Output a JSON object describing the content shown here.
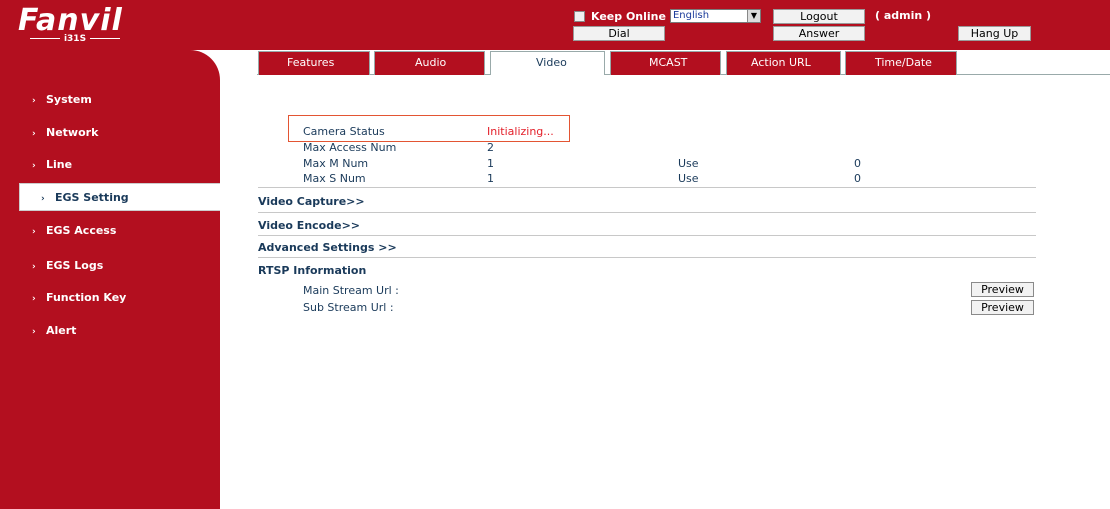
{
  "header": {
    "brand": "Fanvil",
    "model": "i31S",
    "keep_online": "Keep Online",
    "language": "English",
    "logout": "Logout",
    "admin": "( admin )",
    "dial": "Dial",
    "answer": "Answer",
    "hang_up": "Hang Up"
  },
  "sidebar": {
    "items": [
      {
        "label": "System"
      },
      {
        "label": "Network"
      },
      {
        "label": "Line"
      },
      {
        "label": "EGS Setting"
      },
      {
        "label": "EGS Access"
      },
      {
        "label": "EGS Logs"
      },
      {
        "label": "Function Key"
      },
      {
        "label": "Alert"
      }
    ],
    "active_index": 3
  },
  "tabs": [
    {
      "label": "Features"
    },
    {
      "label": "Audio"
    },
    {
      "label": "Video"
    },
    {
      "label": "MCAST"
    },
    {
      "label": "Action URL"
    },
    {
      "label": "Time/Date"
    }
  ],
  "active_tab": 2,
  "status": {
    "camera_status_label": "Camera Status",
    "camera_status_value": "Initializing...",
    "max_access_label": "Max Access Num",
    "max_access_value": "2",
    "max_m_label": "Max M Num",
    "max_m_value": "1",
    "max_m_use_label": "Use",
    "max_m_use_value": "0",
    "max_s_label": "Max S Num",
    "max_s_value": "1",
    "max_s_use_label": "Use",
    "max_s_use_value": "0"
  },
  "sections": {
    "video_capture": "Video Capture>>",
    "video_encode": "Video Encode>>",
    "advanced": "Advanced Settings >>",
    "rtsp": "RTSP Information"
  },
  "rtsp": {
    "main_label": "Main Stream Url :",
    "sub_label": "Sub Stream Url :",
    "preview": "Preview"
  },
  "colors": {
    "brand_red": "#b30f1f",
    "status_red": "#e3202a",
    "text": "#1a3a5a"
  }
}
